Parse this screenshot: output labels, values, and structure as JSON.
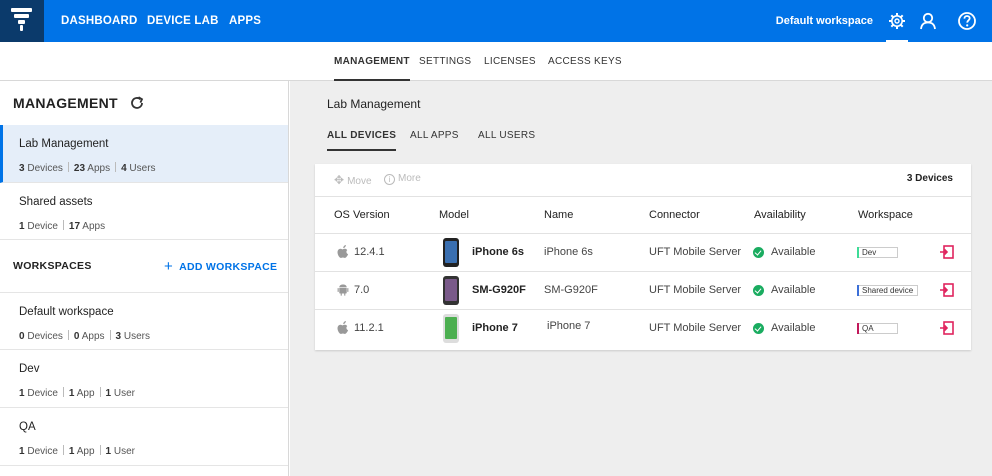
{
  "topbar": {
    "nav": [
      "DASHBOARD",
      "DEVICE LAB",
      "APPS"
    ],
    "workspace_label": "Default workspace",
    "icons": [
      "settings-icon",
      "user-icon",
      "help-icon"
    ]
  },
  "subnav": {
    "tabs": [
      "MANAGEMENT",
      "SETTINGS",
      "LICENSES",
      "ACCESS KEYS"
    ],
    "active": "MANAGEMENT"
  },
  "sidebar": {
    "title": "MANAGEMENT",
    "items": [
      {
        "name": "Lab Management",
        "devices": "3",
        "devices_label": "Devices",
        "apps": "23",
        "apps_label": "Apps",
        "users": "4",
        "users_label": "Users",
        "active": true
      },
      {
        "name": "Shared assets",
        "devices": "1",
        "devices_label": "Device",
        "apps": "17",
        "apps_label": "Apps"
      }
    ],
    "workspaces_label": "WORKSPACES",
    "add_workspace_label": "ADD WORKSPACE",
    "workspaces": [
      {
        "name": "Default workspace",
        "devices": "0",
        "devices_label": "Devices",
        "apps": "0",
        "apps_label": "Apps",
        "users": "3",
        "users_label": "Users"
      },
      {
        "name": "Dev",
        "devices": "1",
        "devices_label": "Device",
        "apps": "1",
        "apps_label": "App",
        "users": "1",
        "users_label": "User"
      },
      {
        "name": "QA",
        "devices": "1",
        "devices_label": "Device",
        "apps": "1",
        "apps_label": "App",
        "users": "1",
        "users_label": "User"
      }
    ]
  },
  "main": {
    "title": "Lab Management",
    "tabs": [
      "ALL DEVICES",
      "ALL APPS",
      "ALL USERS"
    ],
    "active_tab": "ALL DEVICES",
    "toolbar": {
      "move_label": "Move",
      "more_label": "More",
      "count_label": "3 Devices"
    },
    "columns": [
      "OS Version",
      "Model",
      "Name",
      "Connector",
      "Availability",
      "Workspace"
    ],
    "rows": [
      {
        "os": "apple",
        "os_version": "12.4.1",
        "model": "iPhone 6s",
        "name": "iPhone 6s",
        "connector": "UFT Mobile Server",
        "availability": "Available",
        "workspace": "Dev",
        "ws_color": "#3ddc97",
        "screen_color": "#3a6fb0"
      },
      {
        "os": "android",
        "os_version": "7.0",
        "model": "SM-G920F",
        "name": "SM-G920F",
        "connector": "UFT Mobile Server",
        "availability": "Available",
        "workspace": "Shared device",
        "ws_color": "#3b6fd8",
        "screen_color": "#7a5a8a"
      },
      {
        "os": "apple",
        "os_version": "11.2.1",
        "model": "iPhone 7",
        "name": "iPhone 7",
        "connector": "UFT Mobile Server",
        "availability": "Available",
        "workspace": "QA",
        "ws_color": "#c2185b",
        "screen_color": "#4caf50"
      }
    ]
  }
}
